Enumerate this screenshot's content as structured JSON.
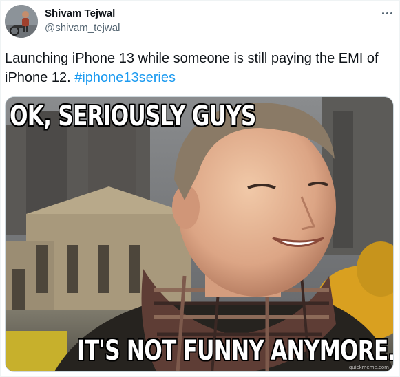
{
  "tweet": {
    "author": {
      "display_name": "Shivam Tejwal",
      "handle": "@shivam_tejwal",
      "avatar_icon": "user-avatar-photo"
    },
    "more_icon": "more-horizontal-icon",
    "text_before_hashtag": "Launching iPhone 13 while someone is still paying the EMI of iPhone 12. ",
    "hashtag": "#iphone13series",
    "colors": {
      "text": "#0f1419",
      "secondary": "#536471",
      "link": "#1d9bf0",
      "border": "#cfd9de"
    }
  },
  "meme": {
    "top_caption": "OK, SERIOUSLY GUYS",
    "bottom_caption": "IT'S NOT FUNNY ANYMORE.",
    "watermark": "quickmeme.com"
  }
}
